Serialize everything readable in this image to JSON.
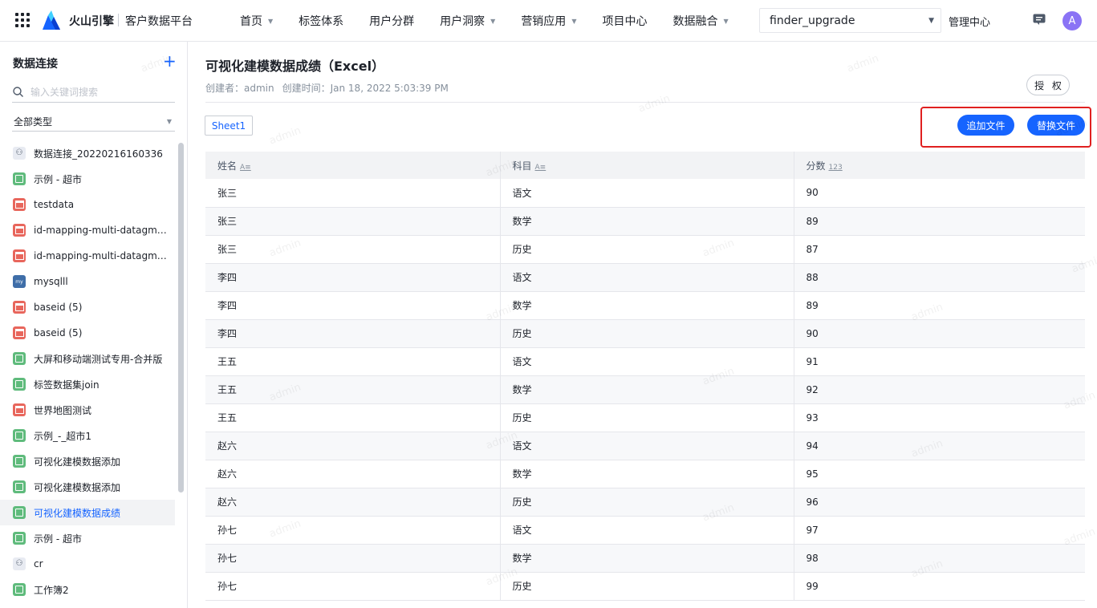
{
  "header": {
    "brand": "火山引擎",
    "product": "客户数据平台",
    "nav": [
      {
        "label": "首页",
        "has_caret": true
      },
      {
        "label": "标签体系",
        "has_caret": false
      },
      {
        "label": "用户分群",
        "has_caret": false
      },
      {
        "label": "用户洞察",
        "has_caret": true
      },
      {
        "label": "营销应用",
        "has_caret": true
      },
      {
        "label": "项目中心",
        "has_caret": false
      },
      {
        "label": "数据融合",
        "has_caret": true
      }
    ],
    "project": "finder_upgrade",
    "admin_center": "管理中心",
    "avatar": "A",
    "icons": [
      "apps-grid-icon",
      "volcano-logo-icon",
      "message-icon"
    ]
  },
  "sidebar": {
    "title": "数据连接",
    "add_icon": "+",
    "search_placeholder": "输入关键词搜索",
    "type_filter": "全部类型",
    "items": [
      {
        "label": "数据连接_20220216160336",
        "icon": "conn",
        "active": false
      },
      {
        "label": "示例 - 超市",
        "icon": "excel",
        "active": false
      },
      {
        "label": "testdata",
        "icon": "db",
        "active": false
      },
      {
        "label": "id-mapping-multi-datagmpcd...",
        "icon": "db",
        "active": false
      },
      {
        "label": "id-mapping-multi-datagmpcd...",
        "icon": "db",
        "active": false
      },
      {
        "label": "mysqlll",
        "icon": "mysql",
        "active": false
      },
      {
        "label": "baseid (5)",
        "icon": "db",
        "active": false
      },
      {
        "label": "baseid (5)",
        "icon": "db",
        "active": false
      },
      {
        "label": "大屏和移动端测试专用-合并版",
        "icon": "excel",
        "active": false
      },
      {
        "label": "标签数据集join",
        "icon": "excel",
        "active": false
      },
      {
        "label": "世界地图测试",
        "icon": "db",
        "active": false
      },
      {
        "label": "示例_-_超市1",
        "icon": "excel",
        "active": false
      },
      {
        "label": "可视化建模数据添加",
        "icon": "excel",
        "active": false
      },
      {
        "label": "可视化建模数据添加",
        "icon": "excel",
        "active": false
      },
      {
        "label": "可视化建模数据成绩",
        "icon": "excel",
        "active": true
      },
      {
        "label": "示例 - 超市",
        "icon": "excel",
        "active": false
      },
      {
        "label": "cr",
        "icon": "conn",
        "active": false
      },
      {
        "label": "工作簿2",
        "icon": "excel",
        "active": false
      }
    ]
  },
  "main": {
    "title": "可视化建模数据成绩（Excel）",
    "creator": "创建者：admin",
    "created_time": "创建时间：Jan 18, 2022 5:03:39 PM",
    "grant_button": "授 权",
    "sheet_tab": "Sheet1",
    "append_button": "追加文件",
    "replace_button": "替换文件",
    "watermark": "admin",
    "columns": [
      {
        "label": "姓名",
        "type": "A≡"
      },
      {
        "label": "科目",
        "type": "A≡"
      },
      {
        "label": "分数",
        "type": "123"
      }
    ],
    "rows": [
      [
        "张三",
        "语文",
        "90"
      ],
      [
        "张三",
        "数学",
        "89"
      ],
      [
        "张三",
        "历史",
        "87"
      ],
      [
        "李四",
        "语文",
        "88"
      ],
      [
        "李四",
        "数学",
        "89"
      ],
      [
        "李四",
        "历史",
        "90"
      ],
      [
        "王五",
        "语文",
        "91"
      ],
      [
        "王五",
        "数学",
        "92"
      ],
      [
        "王五",
        "历史",
        "93"
      ],
      [
        "赵六",
        "语文",
        "94"
      ],
      [
        "赵六",
        "数学",
        "95"
      ],
      [
        "赵六",
        "历史",
        "96"
      ],
      [
        "孙七",
        "语文",
        "97"
      ],
      [
        "孙七",
        "数学",
        "98"
      ],
      [
        "孙七",
        "历史",
        "99"
      ]
    ]
  },
  "colors": {
    "primary": "#1664ff",
    "highlight": "#e02020",
    "avatar": "#8a73f5",
    "excel_icon": "#5fbb7c",
    "db_icon": "#e8665c"
  }
}
